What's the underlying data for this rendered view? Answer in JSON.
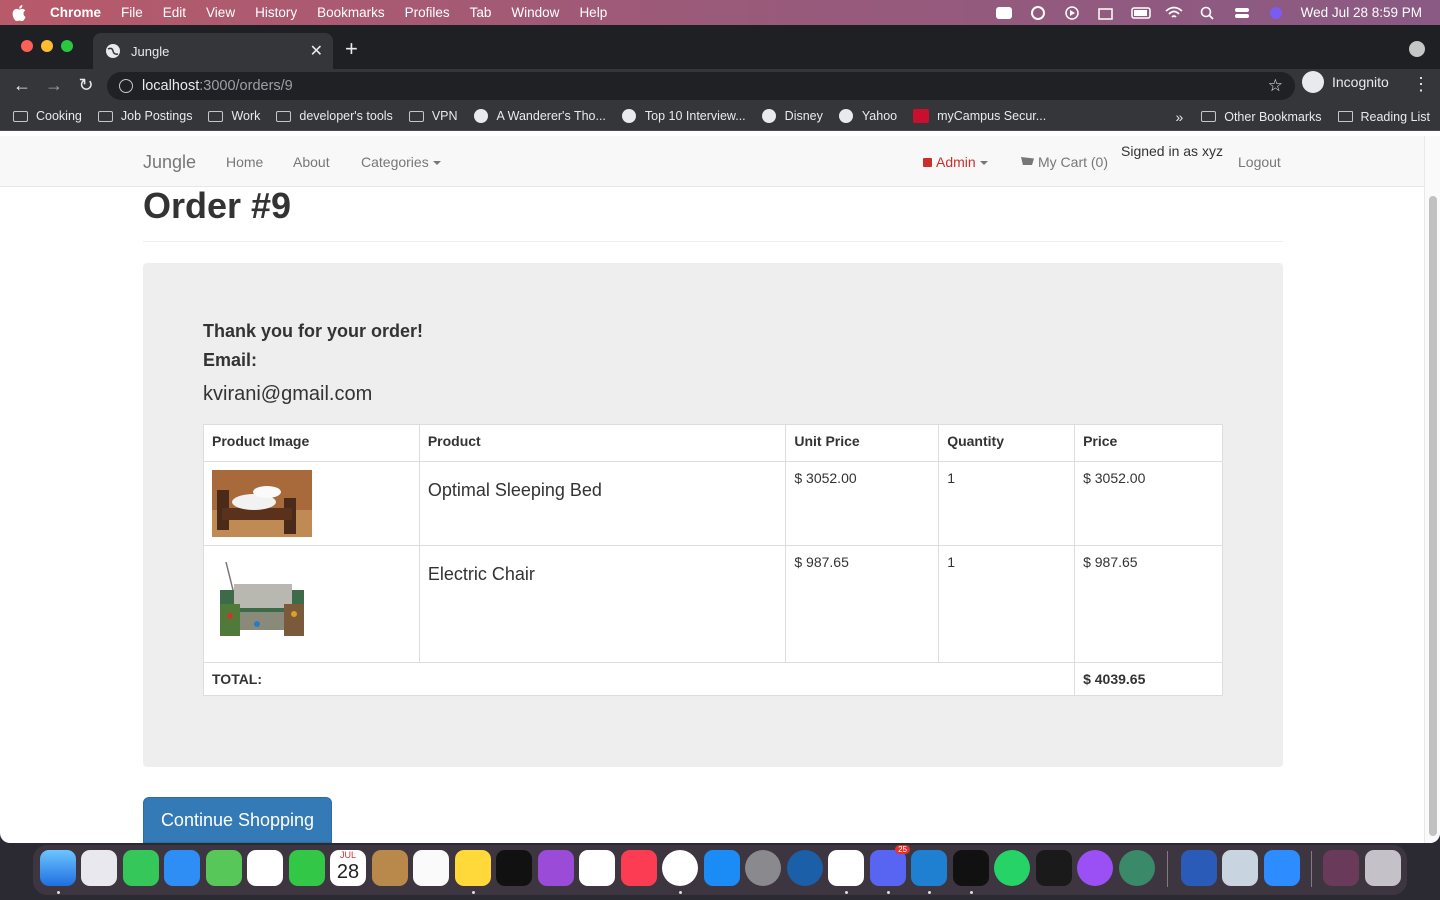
{
  "menubar": {
    "app": "Chrome",
    "items": [
      "File",
      "Edit",
      "View",
      "History",
      "Bookmarks",
      "Profiles",
      "Tab",
      "Window",
      "Help"
    ],
    "clock": "Wed Jul 28  8:59 PM"
  },
  "browser": {
    "tab_title": "Jungle",
    "url_host": "localhost",
    "url_path": ":3000/orders/9",
    "profile": "Incognito",
    "bookmarks": [
      {
        "label": "Cooking",
        "icon": "folder-icon"
      },
      {
        "label": "Job Postings",
        "icon": "folder-icon"
      },
      {
        "label": "Work",
        "icon": "folder-icon"
      },
      {
        "label": "developer's tools",
        "icon": "folder-icon"
      },
      {
        "label": "VPN",
        "icon": "folder-icon"
      },
      {
        "label": "A Wanderer's Tho...",
        "icon": "globe-icon"
      },
      {
        "label": "Top 10 Interview...",
        "icon": "globe-icon"
      },
      {
        "label": "Disney",
        "icon": "globe-icon"
      },
      {
        "label": "Yahoo",
        "icon": "globe-icon"
      },
      {
        "label": "myCampus Secur...",
        "icon": "campus-icon"
      }
    ],
    "other_bookmarks": "Other Bookmarks",
    "reading_list": "Reading List",
    "overflow": "»"
  },
  "nav": {
    "brand": "Jungle",
    "home": "Home",
    "about": "About",
    "categories": "Categories",
    "admin": "Admin",
    "cart": "My Cart (0)",
    "signed_in": "Signed in as xyz",
    "logout": "Logout"
  },
  "order": {
    "title": "Order #9",
    "thanks": "Thank you for your order!",
    "email_label": "Email:",
    "email": "kvirani@gmail.com",
    "columns": [
      "Product Image",
      "Product",
      "Unit Price",
      "Quantity",
      "Price"
    ],
    "rows": [
      {
        "product": "Optimal Sleeping Bed",
        "unit_price": "$ 3052.00",
        "quantity": "1",
        "price": "$ 3052.00"
      },
      {
        "product": "Electric Chair",
        "unit_price": "$ 987.65",
        "quantity": "1",
        "price": "$ 987.65"
      }
    ],
    "total_label": "TOTAL:",
    "total": "$ 4039.65",
    "continue": "Continue Shopping"
  },
  "dock": {
    "calendar_month": "JUL",
    "calendar_day": "28",
    "discord_badge": "25"
  },
  "colors": {
    "accent": "#337ab7",
    "admin": "#c9302c",
    "well": "#eeeeee"
  }
}
